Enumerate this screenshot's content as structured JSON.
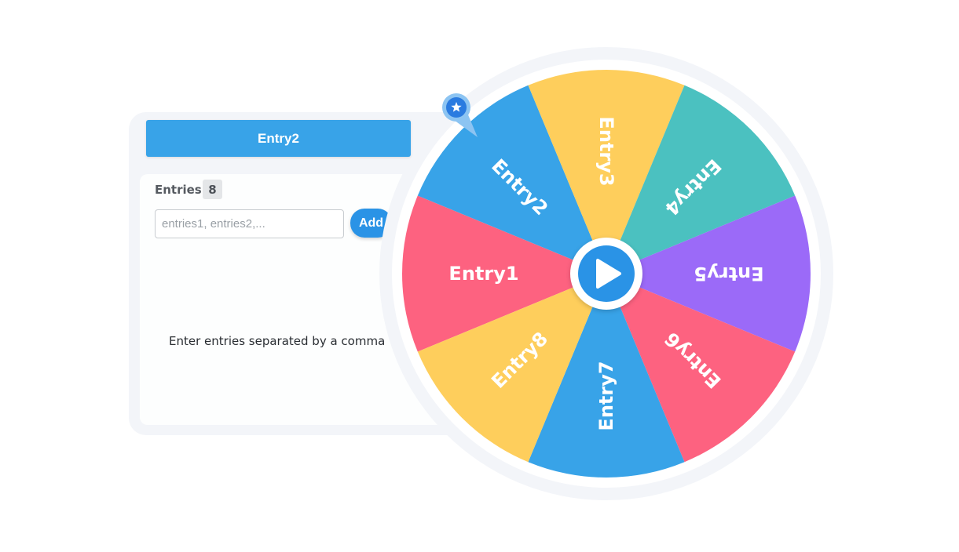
{
  "panel": {
    "result_label": "Entry2",
    "entries_label": "Entries",
    "entries_count": "8",
    "input_value": "",
    "input_placeholder": "entries1, entries2,...",
    "add_label": "Add",
    "hint": "Enter entries separated by a comma"
  },
  "wheel": {
    "segments": [
      {
        "label": "Entry1",
        "color": "#fd6280"
      },
      {
        "label": "Entry2",
        "color": "#38a3e8"
      },
      {
        "label": "Entry3",
        "color": "#fece5c"
      },
      {
        "label": "Entry4",
        "color": "#4bc1c0"
      },
      {
        "label": "Entry5",
        "color": "#9b6af8"
      },
      {
        "label": "Entry6",
        "color": "#fd6280"
      },
      {
        "label": "Entry7",
        "color": "#38a3e8"
      },
      {
        "label": "Entry8",
        "color": "#fece5c"
      }
    ],
    "spin_icon": "play-icon",
    "pointer_icon": "star-marker-icon",
    "accent": "#2a93e6"
  }
}
